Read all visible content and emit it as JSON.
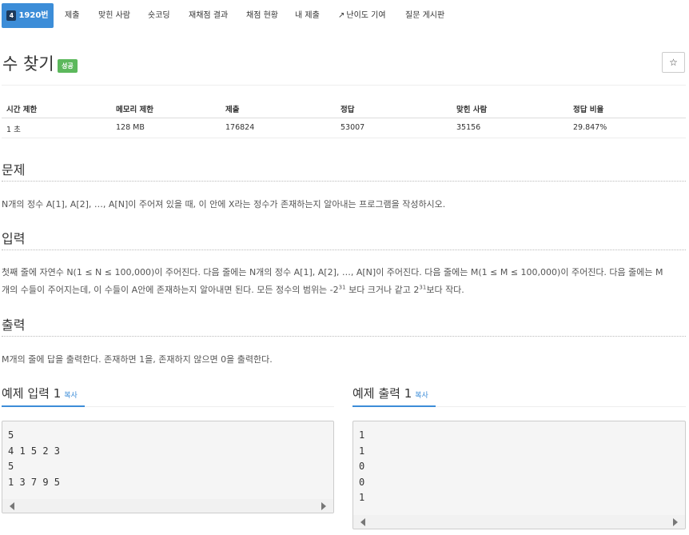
{
  "tabs": [
    {
      "label": "1920번",
      "level": "4",
      "active": true
    },
    {
      "label": "제출"
    },
    {
      "label": "맞힌 사람"
    },
    {
      "label": "숏코딩"
    },
    {
      "label": "재채점 결과"
    },
    {
      "label": "채점 현황"
    },
    {
      "label": "내 제출"
    },
    {
      "label": "난이도 기여",
      "icon": "external-link-icon"
    },
    {
      "label": "질문 게시판"
    }
  ],
  "problem": {
    "title": "수 찾기",
    "status_badge": "성공",
    "star_icon": "☆"
  },
  "info": {
    "headers": [
      "시간 제한",
      "메모리 제한",
      "제출",
      "정답",
      "맞힌 사람",
      "정답 비율"
    ],
    "values": [
      "1 초",
      "128 MB",
      "176824",
      "53007",
      "35156",
      "29.847%"
    ]
  },
  "sections": {
    "problem_heading": "문제",
    "problem_text": "N개의 정수 A[1], A[2], …, A[N]이 주어져 있을 때, 이 안에 X라는 정수가 존재하는지 알아내는 프로그램을 작성하시오.",
    "input_heading": "입력",
    "input_text_line1": "첫째 줄에 자연수 N(1 ≤ N ≤ 100,000)이 주어진다. 다음 줄에는 N개의 정수 A[1], A[2], …, A[N]이 주어진다. 다음 줄에는 M(1 ≤ M ≤ 100,000)이 주어진다. 다음 줄에는 M",
    "input_text_line2_a": "개의 수들이 주어지는데, 이 수들이 A안에 존재하는지 알아내면 된다. 모든 정수의 범위는 -2",
    "input_sup1": "31",
    "input_text_line2_b": " 보다 크거나 같고 2",
    "input_sup2": "31",
    "input_text_line2_c": "보다 작다.",
    "output_heading": "출력",
    "output_text": "M개의 줄에 답을 출력한다. 존재하면 1을, 존재하지 않으면 0을 출력한다."
  },
  "samples": {
    "input_heading": "예제 입력 1",
    "output_heading": "예제 출력 1",
    "copy_label": "복사",
    "input_lines": [
      "5",
      "4 1 5 2 3",
      "5",
      "1 3 7 9 5"
    ],
    "output_lines": [
      "1",
      "1",
      "0",
      "0",
      "1"
    ]
  }
}
